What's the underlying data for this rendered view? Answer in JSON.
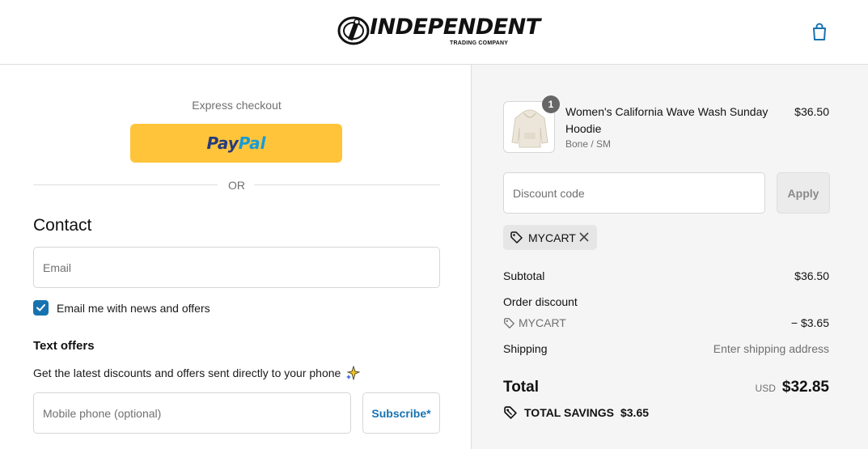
{
  "header": {
    "brand": "INDEPENDENT",
    "brand_sub": "TRADING COMPANY"
  },
  "express": {
    "label": "Express checkout",
    "paypal_a": "Pay",
    "paypal_b": "Pal",
    "or": "OR"
  },
  "contact": {
    "title": "Contact",
    "email_placeholder": "Email",
    "checkbox_label": "Email me with news and offers",
    "checkbox_checked": true
  },
  "text_offers": {
    "title": "Text offers",
    "description": "Get the latest discounts and offers sent directly to your phone",
    "phone_placeholder": "Mobile phone (optional)",
    "subscribe_label": "Subscribe*"
  },
  "order": {
    "item": {
      "quantity": "1",
      "name": "Women's California Wave Wash Sunday Hoodie",
      "variant": "Bone / SM",
      "price": "$36.50"
    },
    "discount_placeholder": "Discount code",
    "apply_label": "Apply",
    "applied_code": "MYCART",
    "subtotal_label": "Subtotal",
    "subtotal_value": "$36.50",
    "order_discount_label": "Order discount",
    "discount_code": "MYCART",
    "discount_value": "− $3.65",
    "shipping_label": "Shipping",
    "shipping_value": "Enter shipping address",
    "total_label": "Total",
    "currency": "USD",
    "total_value": "$32.85",
    "savings_label": "TOTAL SAVINGS",
    "savings_value": "$3.65"
  },
  "colors": {
    "accent": "#1773b0",
    "paypal_yellow": "#ffc439",
    "summary_bg": "#f5f5f5"
  }
}
